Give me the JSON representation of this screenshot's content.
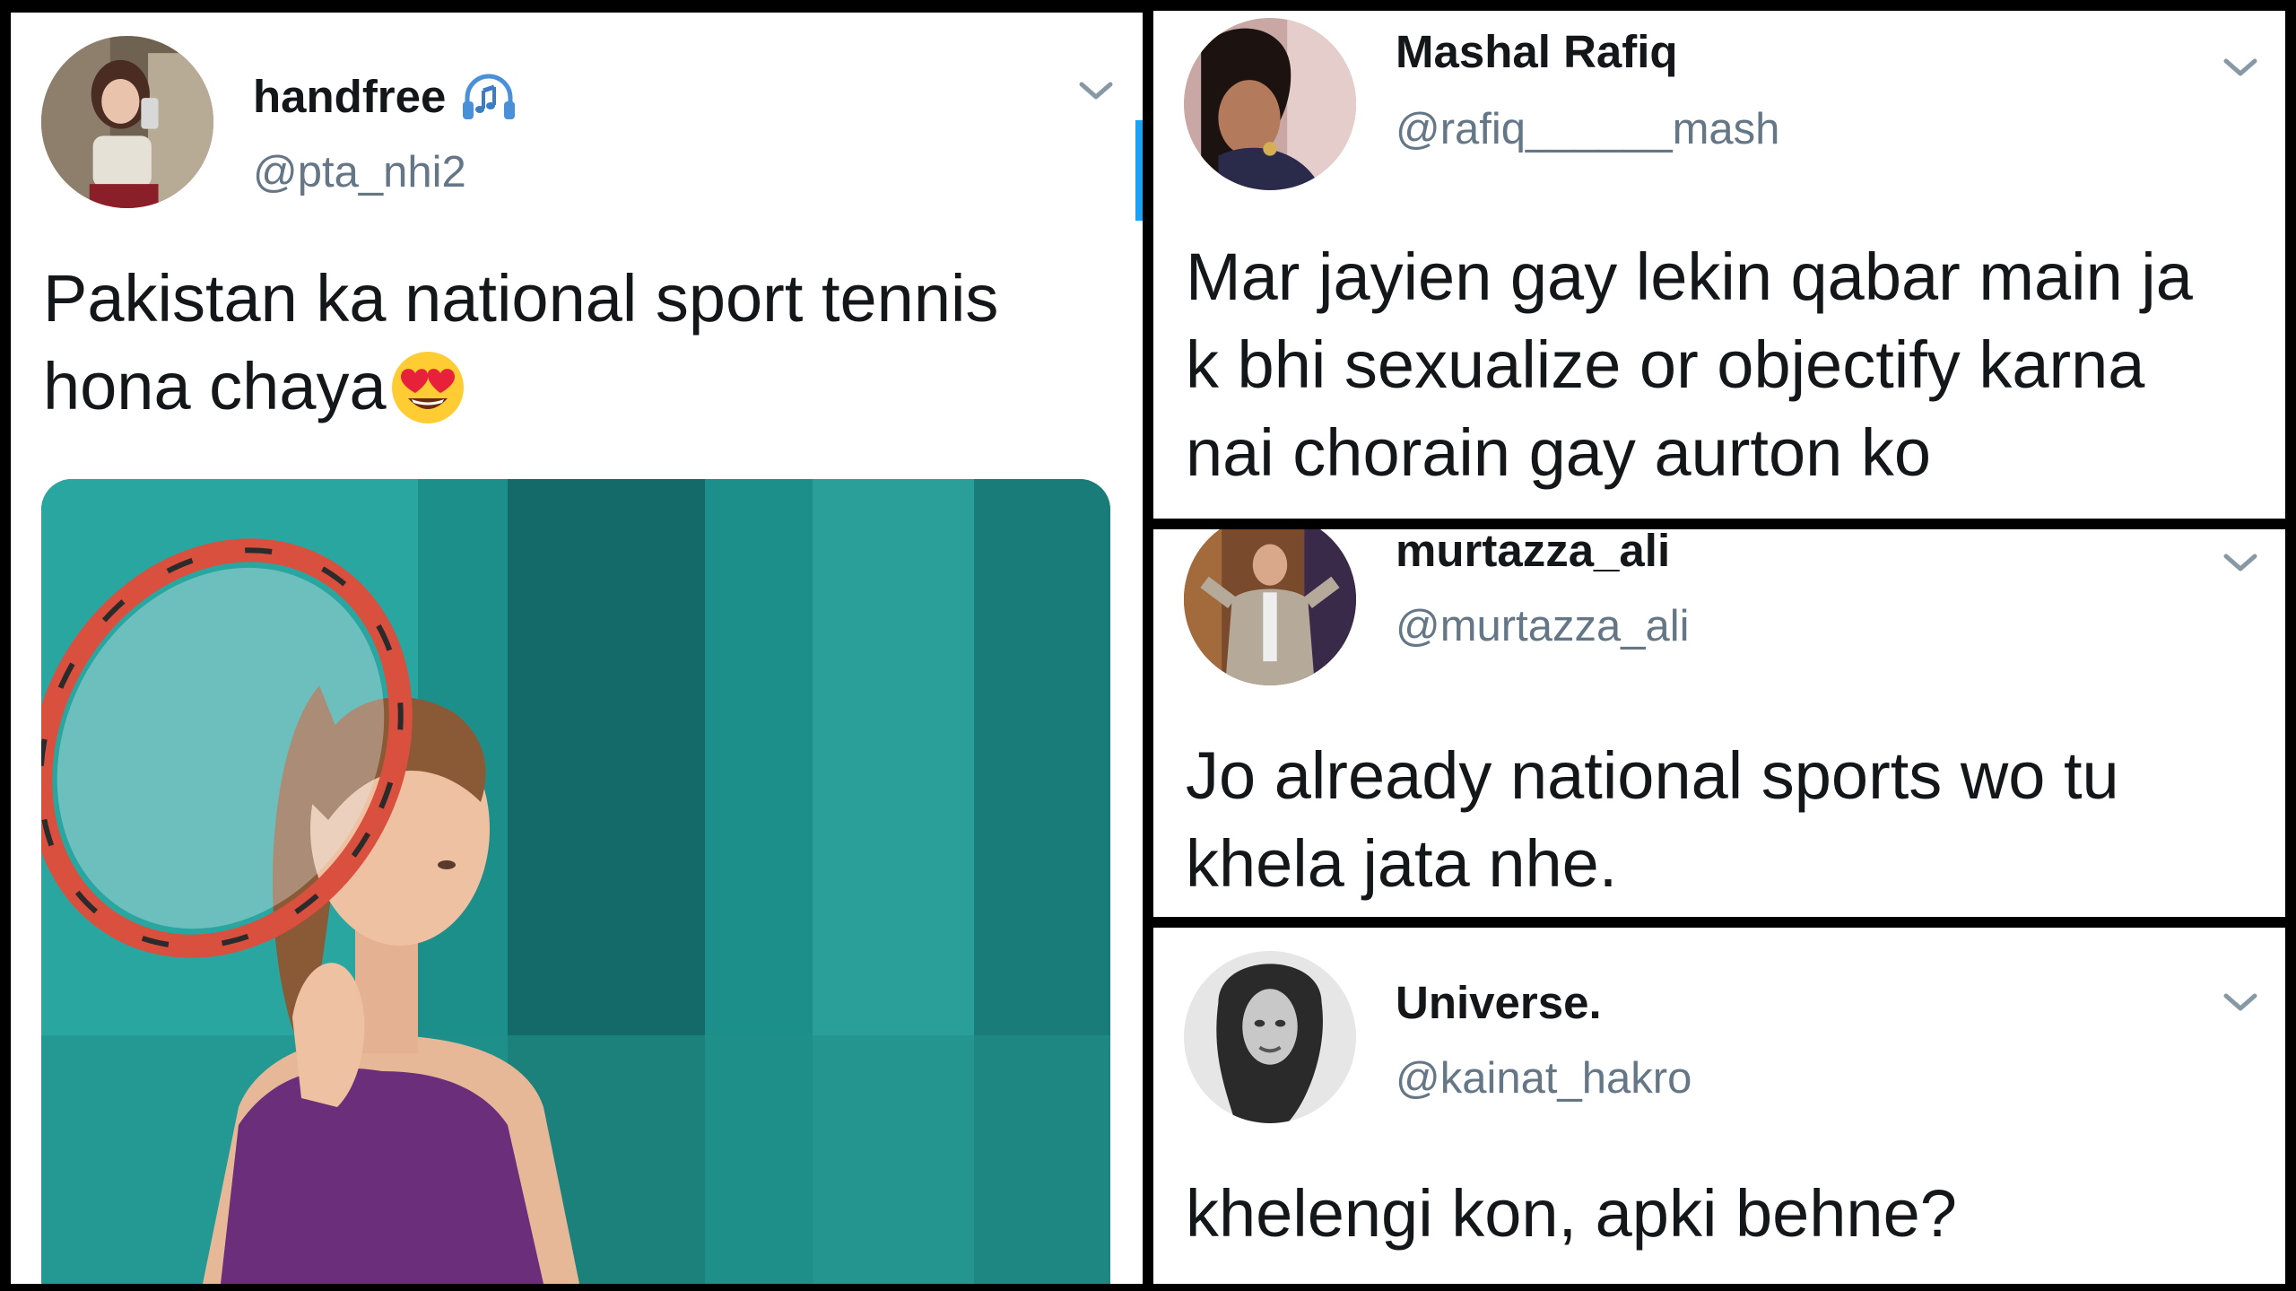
{
  "tweets": [
    {
      "name": "handfree",
      "handle": "@pta_nhi2",
      "text_line1": "Pakistan ka national sport tennis",
      "text_line2": "hona chaya",
      "name_icon": "headphones-icon",
      "emoji": "heart-eyes-emoji"
    },
    {
      "name": "Mashal Rafiq",
      "handle": "@rafiq______mash",
      "text_line1": "Mar jayien gay lekin qabar main ja",
      "text_line2": "k bhi sexualize or objectify karna",
      "text_line3": "nai chorain gay aurton ko"
    },
    {
      "name": "murtazza_ali",
      "handle": "@murtazza_ali",
      "text_line1": "Jo already national sports wo tu",
      "text_line2": "khela jata nhe."
    },
    {
      "name": "Universe.",
      "handle": "@kainat_hakro",
      "text_line1": "khelengi kon, apki behne?"
    }
  ],
  "colors": {
    "name_text": "#14171a",
    "handle_text": "#657786",
    "chevron": "#8899a6",
    "accent": "#1da1f2",
    "separator": "#000000"
  }
}
